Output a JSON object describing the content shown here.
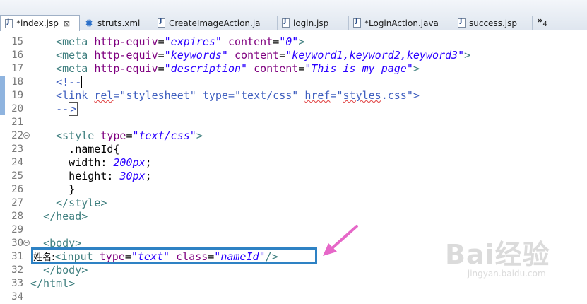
{
  "tabs": [
    {
      "label": "*index.jsp",
      "icon": "jsp-file-icon",
      "active": true,
      "closable": true
    },
    {
      "label": "struts.xml",
      "icon": "gear-icon",
      "active": false
    },
    {
      "label": "CreateImageAction.ja",
      "icon": "java-file-icon",
      "active": false
    },
    {
      "label": "login.jsp",
      "icon": "jsp-file-icon",
      "active": false
    },
    {
      "label": "*LoginAction.java",
      "icon": "java-file-icon",
      "active": false
    },
    {
      "label": "success.jsp",
      "icon": "jsp-file-icon",
      "active": false
    }
  ],
  "tab_overflow": {
    "symbol": "»",
    "count": "4"
  },
  "lines": [
    {
      "n": "15",
      "parts": [
        [
          "txt",
          "    "
        ],
        [
          "tag",
          "<meta "
        ],
        [
          "attr",
          "http-equiv"
        ],
        [
          "txt",
          "="
        ],
        [
          "val",
          "\"expires\""
        ],
        [
          "txt",
          " "
        ],
        [
          "attr",
          "content"
        ],
        [
          "txt",
          "="
        ],
        [
          "val",
          "\"0\""
        ],
        [
          "tag",
          ">"
        ]
      ]
    },
    {
      "n": "16",
      "parts": [
        [
          "txt",
          "    "
        ],
        [
          "tag",
          "<meta "
        ],
        [
          "attr",
          "http-equiv"
        ],
        [
          "txt",
          "="
        ],
        [
          "val",
          "\"keywords\""
        ],
        [
          "txt",
          " "
        ],
        [
          "attr",
          "content"
        ],
        [
          "txt",
          "="
        ],
        [
          "val",
          "\"keyword1,keyword2,keyword3\""
        ],
        [
          "tag",
          ">"
        ]
      ]
    },
    {
      "n": "17",
      "parts": [
        [
          "txt",
          "    "
        ],
        [
          "tag",
          "<meta "
        ],
        [
          "attr",
          "http-equiv"
        ],
        [
          "txt",
          "="
        ],
        [
          "val",
          "\"description\""
        ],
        [
          "txt",
          " "
        ],
        [
          "attr",
          "content"
        ],
        [
          "txt",
          "="
        ],
        [
          "val",
          "\"This is my page\""
        ],
        [
          "tag",
          ">"
        ]
      ]
    },
    {
      "n": "18",
      "parts": [
        [
          "txt",
          "    "
        ],
        [
          "cmt",
          "<!--"
        ]
      ]
    },
    {
      "n": "19",
      "parts": [
        [
          "txt",
          "    "
        ],
        [
          "cmt",
          "<link rel=\"stylesheet\" type=\"text/css\" href=\"styles.css\">"
        ]
      ]
    },
    {
      "n": "20",
      "parts": [
        [
          "txt",
          "    "
        ],
        [
          "cmt",
          "-->"
        ]
      ]
    },
    {
      "n": "21",
      "parts": []
    },
    {
      "n": "22",
      "parts": [
        [
          "txt",
          "    "
        ],
        [
          "tag",
          "<style "
        ],
        [
          "attr",
          "type"
        ],
        [
          "txt",
          "="
        ],
        [
          "val",
          "\"text/css\""
        ],
        [
          "tag",
          ">"
        ]
      ]
    },
    {
      "n": "23",
      "parts": [
        [
          "txt",
          "      .nameId{"
        ]
      ]
    },
    {
      "n": "24",
      "parts": [
        [
          "txt",
          "      width: "
        ],
        [
          "val",
          "200px"
        ],
        [
          "txt",
          ";"
        ]
      ]
    },
    {
      "n": "25",
      "parts": [
        [
          "txt",
          "      height: "
        ],
        [
          "val",
          "30px"
        ],
        [
          "txt",
          ";"
        ]
      ]
    },
    {
      "n": "26",
      "parts": [
        [
          "txt",
          "      }"
        ]
      ]
    },
    {
      "n": "27",
      "parts": [
        [
          "txt",
          "    "
        ],
        [
          "tag",
          "</style>"
        ]
      ]
    },
    {
      "n": "28",
      "parts": [
        [
          "txt",
          "  "
        ],
        [
          "tag",
          "</head>"
        ]
      ]
    },
    {
      "n": "29",
      "parts": []
    },
    {
      "n": "30",
      "parts": [
        [
          "txt",
          "  "
        ],
        [
          "tag",
          "<body>"
        ]
      ]
    },
    {
      "n": "31",
      "parts": [
        [
          "label",
          " 姓名:"
        ],
        [
          "tag",
          "<input "
        ],
        [
          "attr",
          "type"
        ],
        [
          "txt",
          "="
        ],
        [
          "val",
          "\"text\""
        ],
        [
          "txt",
          " "
        ],
        [
          "attr",
          "class"
        ],
        [
          "txt",
          "="
        ],
        [
          "val",
          "\"nameId\""
        ],
        [
          "tag",
          "/>"
        ]
      ]
    },
    {
      "n": "32",
      "parts": [
        [
          "txt",
          "  "
        ],
        [
          "tag",
          "</body>"
        ]
      ]
    },
    {
      "n": "33",
      "parts": [
        [
          "tag",
          "</html>"
        ]
      ]
    },
    {
      "n": "34",
      "parts": []
    }
  ],
  "watermark": {
    "brand": "Bai经验",
    "site": "jingyan.baidu.com"
  },
  "colors": {
    "highlight_box": "#2e82c4",
    "arrow": "#e667c8",
    "tag": "#3f7f7f",
    "attr": "#7f007f",
    "value": "#2a00ff",
    "comment": "#3f5fbf"
  }
}
